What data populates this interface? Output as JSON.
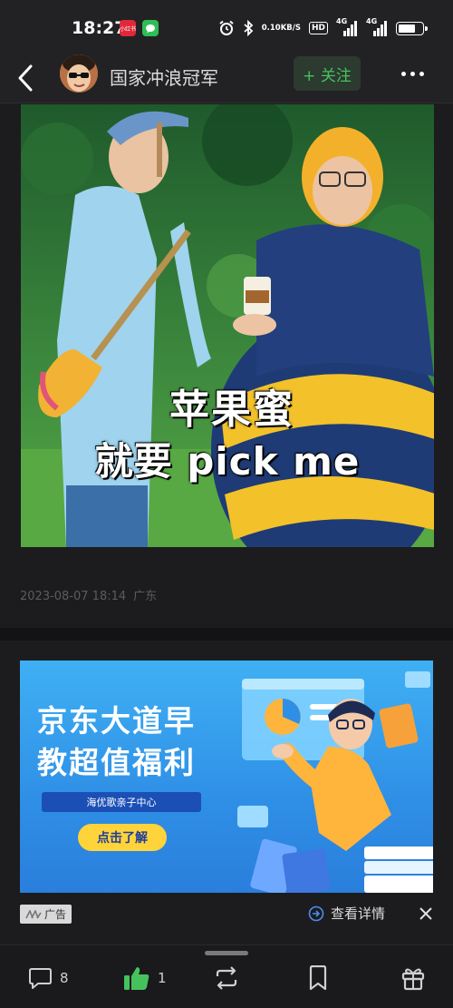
{
  "status_bar": {
    "time": "18:27",
    "app_badge_1": "小红书",
    "net_speed_value": "0.10",
    "net_speed_unit": "KB/S",
    "hd_label": "HD",
    "signal_1_label": "4G",
    "signal_2_label": "4G",
    "battery_level": 0.75
  },
  "header": {
    "channel_name": "国家冲浪冠军",
    "follow_label": "+ 关注"
  },
  "video": {
    "caption_line_1": "苹果蜜",
    "caption_line_2": "就要 pick me"
  },
  "post_meta": {
    "datetime": "2023-08-07 18:14",
    "location": "广东"
  },
  "ad": {
    "headline_line_1": "京东大道早",
    "headline_line_2": "教超值福利",
    "chip_text": "海优歌亲子中心",
    "cta_text": "点击了解",
    "ad_label": "广告",
    "details_label": "查看详情"
  },
  "bottom_bar": {
    "comment_count": "8",
    "like_count": "1"
  },
  "colors": {
    "background": "#1c1c1e",
    "accent_green": "#46c25d",
    "ad_blue": "#2f8fe6",
    "cta_yellow": "#ffd33a"
  }
}
